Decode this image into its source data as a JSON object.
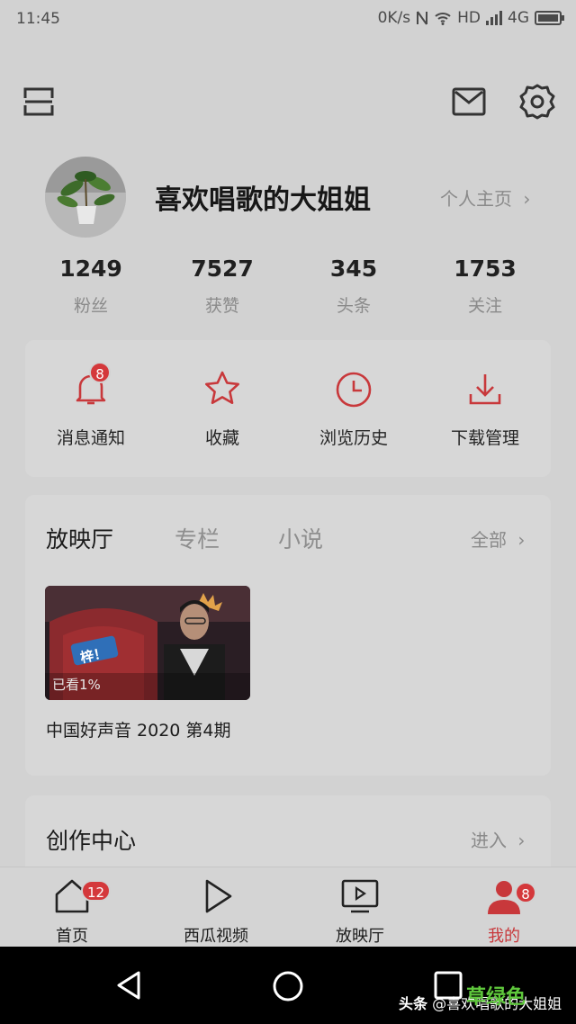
{
  "status_bar": {
    "time": "11:45",
    "speed": "0K/s",
    "hd": "HD",
    "network": "4G"
  },
  "profile": {
    "name": "喜欢唱歌的大姐姐",
    "homepage_link": "个人主页",
    "stats": [
      {
        "value": "1249",
        "label": "粉丝"
      },
      {
        "value": "7527",
        "label": "获赞"
      },
      {
        "value": "345",
        "label": "头条"
      },
      {
        "value": "1753",
        "label": "关注"
      }
    ]
  },
  "quick_actions": [
    {
      "label": "消息通知",
      "icon": "bell-icon",
      "badge": "8"
    },
    {
      "label": "收藏",
      "icon": "star-icon"
    },
    {
      "label": "浏览历史",
      "icon": "clock-icon"
    },
    {
      "label": "下载管理",
      "icon": "download-icon"
    }
  ],
  "media_section": {
    "tabs": [
      "放映厅",
      "专栏",
      "小说"
    ],
    "all_link": "全部",
    "video": {
      "progress_label": "已看1%",
      "title": "中国好声音 2020 第4期",
      "sticker": "梓！"
    }
  },
  "creator_center": {
    "title": "创作中心",
    "enter_link": "进入"
  },
  "bottom_nav": [
    {
      "label": "首页",
      "icon": "home-icon",
      "badge": "12"
    },
    {
      "label": "西瓜视频",
      "icon": "play-icon"
    },
    {
      "label": "放映厅",
      "icon": "tv-icon"
    },
    {
      "label": "我的",
      "icon": "profile-icon",
      "badge": "8",
      "active": true
    }
  ],
  "watermark": {
    "prefix": "头条",
    "handle": "@喜欢唱歌的大姐姐",
    "overlay": "草绿色"
  },
  "colors": {
    "accent": "#c8383b",
    "background": "#d2d2d2"
  }
}
